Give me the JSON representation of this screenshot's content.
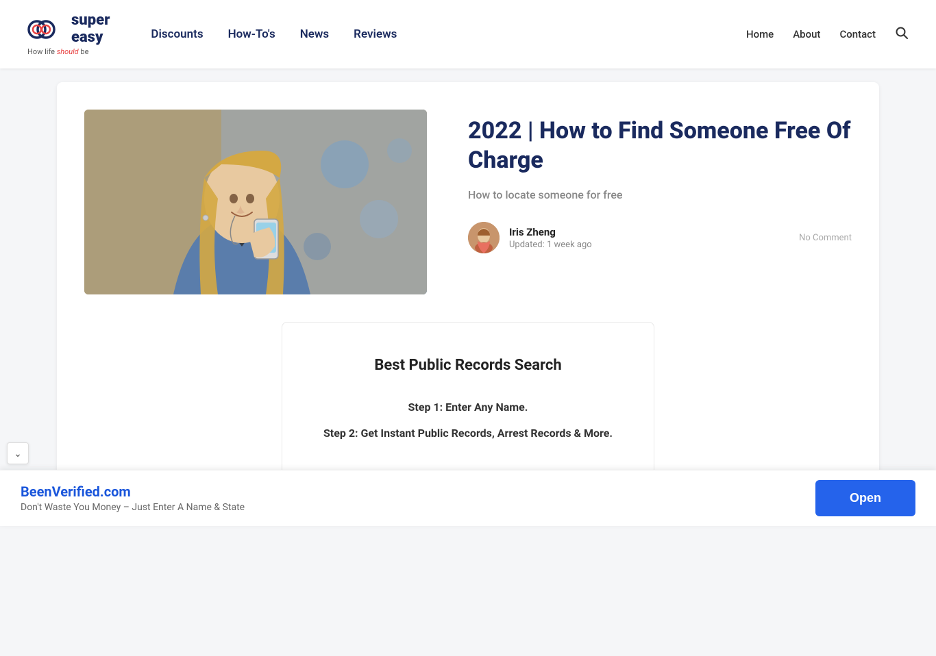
{
  "site": {
    "logo_tagline": "How life ",
    "logo_tagline_emphasis": "should",
    "logo_tagline_end": " be"
  },
  "header": {
    "nav_items": [
      {
        "label": "Discounts",
        "href": "#"
      },
      {
        "label": "How-To's",
        "href": "#"
      },
      {
        "label": "News",
        "href": "#"
      },
      {
        "label": "Reviews",
        "href": "#"
      }
    ],
    "right_nav": [
      {
        "label": "Home",
        "href": "#"
      },
      {
        "label": "About",
        "href": "#"
      },
      {
        "label": "Contact",
        "href": "#"
      }
    ]
  },
  "article": {
    "title": "2022 | How to Find Someone Free Of Charge",
    "subtitle": "How to locate someone for free",
    "author_name": "Iris Zheng",
    "updated": "Updated: 1 week ago",
    "no_comment": "No Comment"
  },
  "content_box": {
    "title": "Best Public Records Search",
    "step1": "Step 1: Enter Any Name.",
    "step2": "Step 2: Get Instant Public Records, Arrest Records & More."
  },
  "ad_bar": {
    "site_name": "BeenVerified.com",
    "description": "Don't Waste You Money – Just Enter A Name & State",
    "open_button": "Open"
  },
  "collapse_button": "⌄"
}
